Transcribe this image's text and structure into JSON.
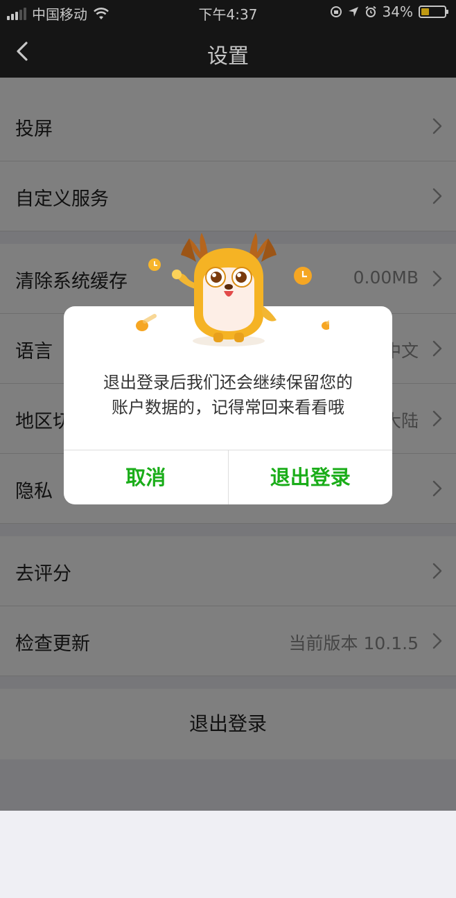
{
  "status_bar": {
    "carrier": "中国移动",
    "time": "下午4:37",
    "battery_percent_text": "34%",
    "battery_level": 0.34,
    "battery_color": "#f5c518"
  },
  "nav": {
    "back_icon": "chevron-left-icon",
    "title": "设置"
  },
  "settings": {
    "rows": [
      {
        "label": "投屏",
        "value": ""
      },
      {
        "label": "自定义服务",
        "value": ""
      },
      {
        "label": "清除系统缓存",
        "value": "0.00MB"
      },
      {
        "label": "语言",
        "value": "中文"
      },
      {
        "label": "地区切换",
        "value": "大陆"
      },
      {
        "label": "隐私",
        "value": ""
      },
      {
        "label": "去评分",
        "value": ""
      },
      {
        "label": "检查更新",
        "value": "当前版本 10.1.5"
      }
    ],
    "logout_label": "退出登录"
  },
  "dialog": {
    "message_line1": "退出登录后我们还会继续保留您的",
    "message_line2": "账户数据的，记得常回来看看哦",
    "cancel_label": "取消",
    "confirm_label": "退出登录",
    "button_color": "#1aad19",
    "mascot": "deer-mascot-illustration"
  }
}
